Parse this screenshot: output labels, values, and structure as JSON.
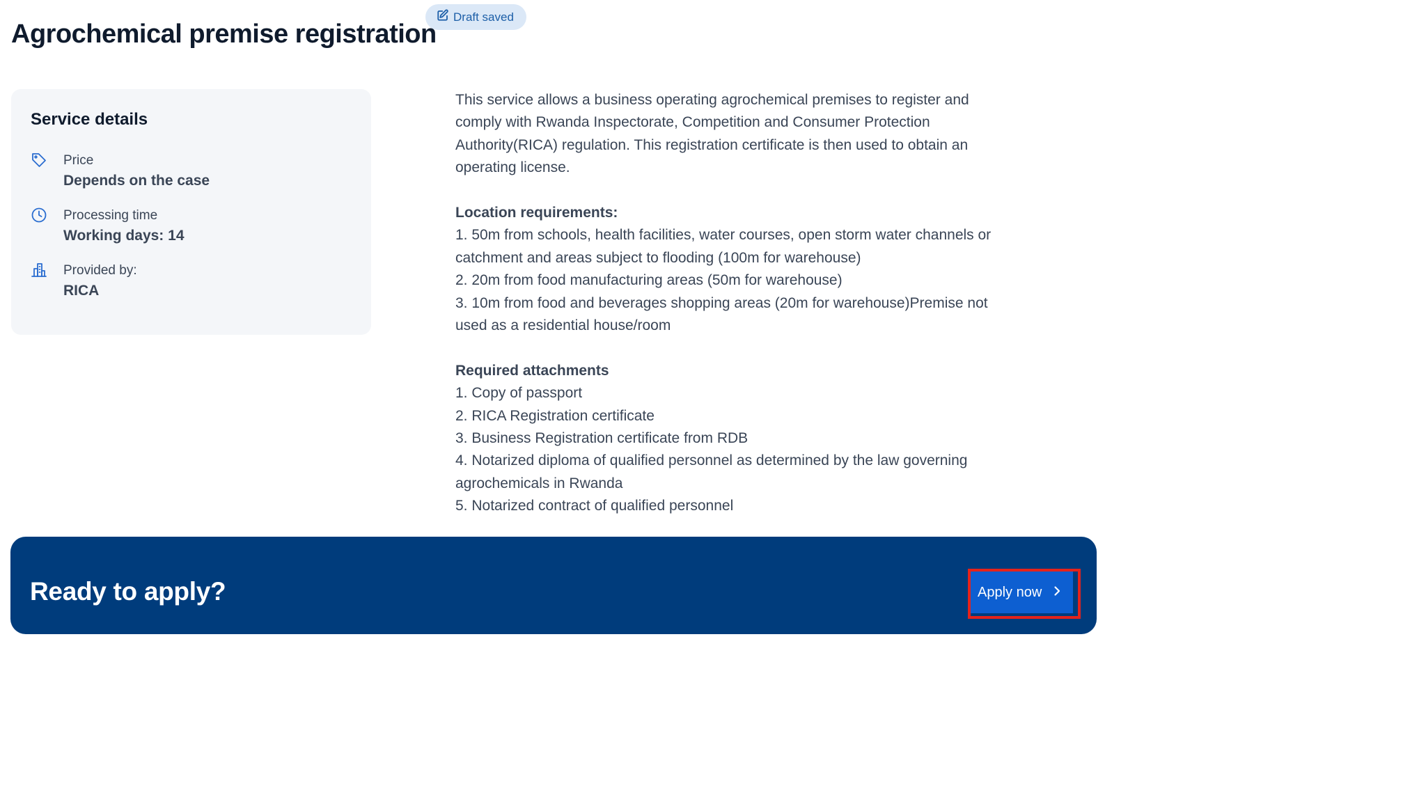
{
  "header": {
    "title": "Agrochemical premise registration",
    "draft_badge": {
      "label": "Draft saved",
      "icon": "edit-icon"
    }
  },
  "service_details": {
    "heading": "Service details",
    "items": [
      {
        "icon": "tag-icon",
        "label": "Price",
        "value": "Depends on the case"
      },
      {
        "icon": "clock-icon",
        "label": "Processing time",
        "value": "Working days: 14"
      },
      {
        "icon": "building-icon",
        "label": "Provided by:",
        "value": "RICA"
      }
    ]
  },
  "description": {
    "intro": "This service allows a business operating agrochemical premises to register and comply with Rwanda Inspectorate, Competition and Consumer Protection Authority(RICA) regulation. This registration certificate is then used to obtain an operating license.",
    "location_title": "Location requirements:",
    "location_items": [
      "1. 50m from schools, health facilities, water courses, open storm water channels or catchment and areas subject to flooding (100m for warehouse)",
      "2. 20m from food manufacturing areas (50m for warehouse)",
      "3. 10m from food and beverages shopping areas (20m for warehouse)Premise not used as a residential house/room"
    ],
    "attachments_title": "Required attachments",
    "attachments_items": [
      "1. Copy of passport",
      "2. RICA Registration certificate",
      "3. Business Registration certificate from RDB",
      "4. Notarized diploma of qualified personnel as determined by the law governing agrochemicals in Rwanda",
      "5. Notarized contract of qualified personnel"
    ]
  },
  "apply_banner": {
    "heading": "Ready to apply?",
    "button_label": "Apply now",
    "button_icon": "chevron-right-icon"
  },
  "colors": {
    "banner_bg": "#003c7c",
    "button_bg": "#0d5fd1",
    "highlight": "#e4231b",
    "badge_bg": "#dbe8f7",
    "card_bg": "#f4f6f9",
    "icon_accent": "#2a6dd0"
  }
}
